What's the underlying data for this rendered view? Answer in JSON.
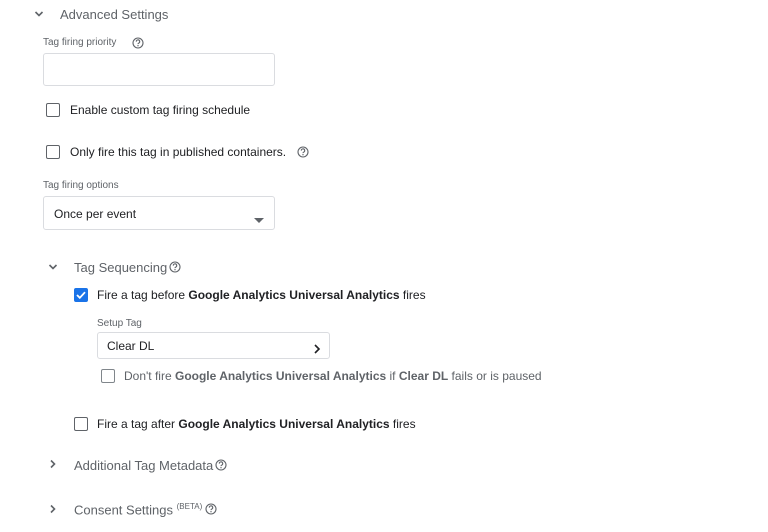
{
  "advanced": {
    "title": "Advanced Settings",
    "priority_label": "Tag firing priority",
    "priority_value": "",
    "custom_schedule_label": "Enable custom tag firing schedule",
    "published_only_label": "Only fire this tag in published containers.",
    "firing_options_label": "Tag firing options",
    "firing_option_selected": "Once per event"
  },
  "sequencing": {
    "title": "Tag Sequencing",
    "before": {
      "prefix": "Fire a tag before ",
      "tag_name": "Google Analytics Universal Analytics",
      "suffix": " fires",
      "checked": true
    },
    "setup_tag_label": "Setup Tag",
    "setup_tag_value": "Clear DL",
    "dont_fire": {
      "prefix": "Don't fire ",
      "tag_name": "Google Analytics Universal Analytics",
      "middle": " if ",
      "setup_name": "Clear DL",
      "suffix": " fails or is paused"
    },
    "after": {
      "prefix": "Fire a tag after ",
      "tag_name": "Google Analytics Universal Analytics",
      "suffix": " fires"
    }
  },
  "metadata": {
    "title": "Additional Tag Metadata"
  },
  "consent": {
    "title": "Consent Settings",
    "badge": "(BETA)"
  },
  "colors": {
    "accent": "#1a73e8",
    "text": "#202124",
    "secondary": "#5f6368",
    "border": "#dadce0"
  }
}
